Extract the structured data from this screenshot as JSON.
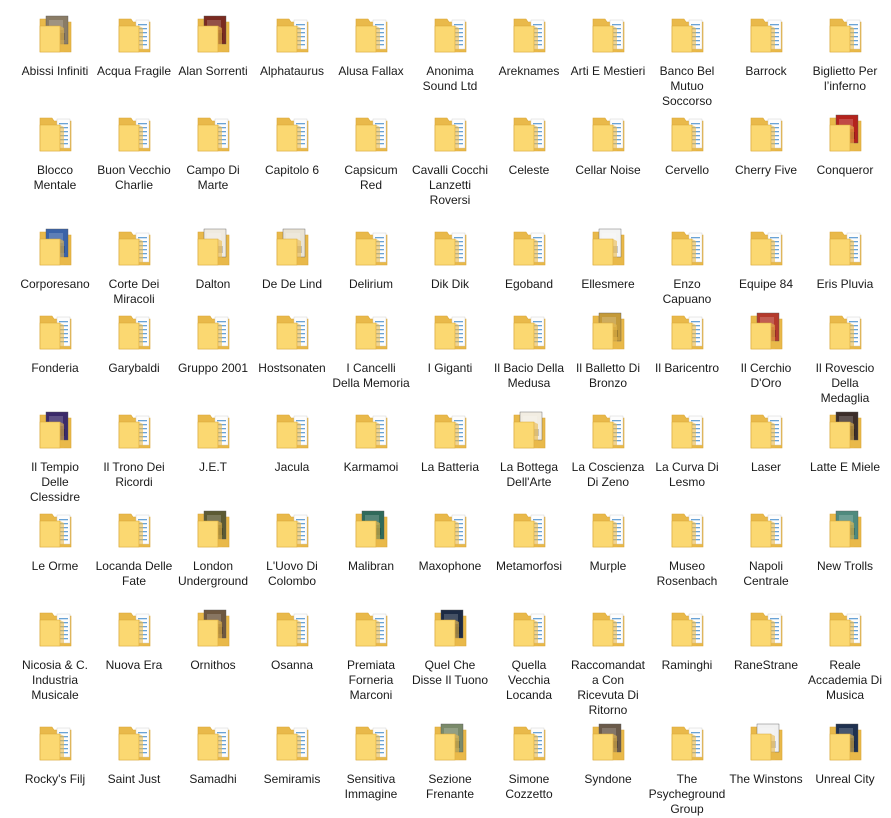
{
  "colors": {
    "folder_back": "#e9b94a",
    "folder_front": "#fbd871",
    "folder_edge": "#d9a637",
    "paper": "#fdfdfd",
    "paper_lines": "#6aa3d6",
    "label_text": "#1a1a1a"
  },
  "folders": [
    {
      "label": "Abissi Infiniti",
      "cover": "#8a7c66"
    },
    {
      "label": "Acqua Fragile",
      "cover": null
    },
    {
      "label": "Alan Sorrenti",
      "cover": "#7a2a20"
    },
    {
      "label": "Alphataurus",
      "cover": null
    },
    {
      "label": "Alusa Fallax",
      "cover": null
    },
    {
      "label": "Anonima Sound Ltd",
      "cover": null
    },
    {
      "label": "Areknames",
      "cover": null
    },
    {
      "label": "Arti E Mestieri",
      "cover": null
    },
    {
      "label": "Banco Bel Mutuo Soccorso",
      "cover": null
    },
    {
      "label": "Barrock",
      "cover": null
    },
    {
      "label": "Biglietto Per l’inferno",
      "cover": null
    },
    {
      "label": "Blocco Mentale",
      "cover": null
    },
    {
      "label": "Buon Vecchio Charlie",
      "cover": null
    },
    {
      "label": "Campo Di Marte",
      "cover": null
    },
    {
      "label": "Capitolo 6",
      "cover": null
    },
    {
      "label": "Capsicum Red",
      "cover": null
    },
    {
      "label": "Cavalli Cocchi Lanzetti Roversi",
      "cover": null
    },
    {
      "label": "Celeste",
      "cover": null
    },
    {
      "label": "Cellar Noise",
      "cover": null
    },
    {
      "label": "Cervello",
      "cover": null
    },
    {
      "label": "Cherry Five",
      "cover": null
    },
    {
      "label": "Conqueror",
      "cover": "#b4231d"
    },
    {
      "label": "Corporesano",
      "cover": "#3a63a8"
    },
    {
      "label": "Corte Dei Miracoli",
      "cover": null
    },
    {
      "label": "Dalton",
      "cover": "#efeae0"
    },
    {
      "label": "De De Lind",
      "cover": "#e9e3d4"
    },
    {
      "label": "Delirium",
      "cover": null
    },
    {
      "label": "Dik Dik",
      "cover": null
    },
    {
      "label": "Egoband",
      "cover": null
    },
    {
      "label": "Ellesmere",
      "cover": "#f4f4f4"
    },
    {
      "label": "Enzo Capuano",
      "cover": null
    },
    {
      "label": "Equipe 84",
      "cover": null
    },
    {
      "label": "Eris Pluvia",
      "cover": null
    },
    {
      "label": "Fonderia",
      "cover": null
    },
    {
      "label": "Garybaldi",
      "cover": null
    },
    {
      "label": "Gruppo 2001",
      "cover": null
    },
    {
      "label": "Hostsonaten",
      "cover": null
    },
    {
      "label": "I Cancelli Della Memoria",
      "cover": null
    },
    {
      "label": "I Giganti",
      "cover": null
    },
    {
      "label": "Il Bacio Della Medusa",
      "cover": null
    },
    {
      "label": "Il Balletto Di Bronzo",
      "cover": "#c49a3a"
    },
    {
      "label": "Il Baricentro",
      "cover": null
    },
    {
      "label": "Il Cerchio D'Oro",
      "cover": "#b43a2c"
    },
    {
      "label": "Il Rovescio Della Medaglia",
      "cover": null
    },
    {
      "label": "Il Tempio Delle Clessidre",
      "cover": "#3b2a6a"
    },
    {
      "label": "Il Trono Dei Ricordi",
      "cover": null
    },
    {
      "label": "J.E.T",
      "cover": null
    },
    {
      "label": "Jacula",
      "cover": null
    },
    {
      "label": "Karmamoi",
      "cover": null
    },
    {
      "label": "La Batteria",
      "cover": null
    },
    {
      "label": "La Bottega Dell'Arte",
      "cover": "#f2ede2"
    },
    {
      "label": "La Coscienza Di Zeno",
      "cover": null
    },
    {
      "label": "La Curva Di Lesmo",
      "cover": null
    },
    {
      "label": "Laser",
      "cover": null
    },
    {
      "label": "Latte E Miele",
      "cover": "#3c2e2a"
    },
    {
      "label": "Le Orme",
      "cover": null
    },
    {
      "label": "Locanda Delle Fate",
      "cover": null
    },
    {
      "label": "London Underground",
      "cover": "#5c5a34"
    },
    {
      "label": "L'Uovo Di Colombo",
      "cover": null
    },
    {
      "label": "Malibran",
      "cover": "#2f6a5a"
    },
    {
      "label": "Maxophone",
      "cover": null
    },
    {
      "label": "Metamorfosi",
      "cover": null
    },
    {
      "label": "Murple",
      "cover": null
    },
    {
      "label": "Museo Rosenbach",
      "cover": null
    },
    {
      "label": "Napoli Centrale",
      "cover": null
    },
    {
      "label": "New Trolls",
      "cover": "#4f8a7e"
    },
    {
      "label": "Nicosia & C. Industria Musicale",
      "cover": null
    },
    {
      "label": "Nuova Era",
      "cover": null
    },
    {
      "label": "Ornithos",
      "cover": "#6e5840"
    },
    {
      "label": "Osanna",
      "cover": null
    },
    {
      "label": "Premiata Forneria Marconi",
      "cover": null
    },
    {
      "label": "Quel Che Disse Il Tuono",
      "cover": "#1d2b44"
    },
    {
      "label": "Quella Vecchia Locanda",
      "cover": null
    },
    {
      "label": "Raccomandata Con Ricevuta Di Ritorno",
      "cover": null
    },
    {
      "label": "Raminghi",
      "cover": null
    },
    {
      "label": "RaneStrane",
      "cover": null
    },
    {
      "label": "Reale Accademia Di Musica",
      "cover": null
    },
    {
      "label": "Rocky's Filj",
      "cover": null
    },
    {
      "label": "Saint Just",
      "cover": null
    },
    {
      "label": "Samadhi",
      "cover": null
    },
    {
      "label": "Semiramis",
      "cover": null
    },
    {
      "label": "Sensitiva Immagine",
      "cover": null
    },
    {
      "label": "Sezione Frenante",
      "cover": "#7a8a6a"
    },
    {
      "label": "Simone Cozzetto",
      "cover": null
    },
    {
      "label": "Syndone",
      "cover": "#6a5a4a"
    },
    {
      "label": "The Psycheground Group",
      "cover": null
    },
    {
      "label": "The Winstons",
      "cover": "#f1f1f1"
    },
    {
      "label": "Unreal City",
      "cover": "#1f3150"
    }
  ]
}
